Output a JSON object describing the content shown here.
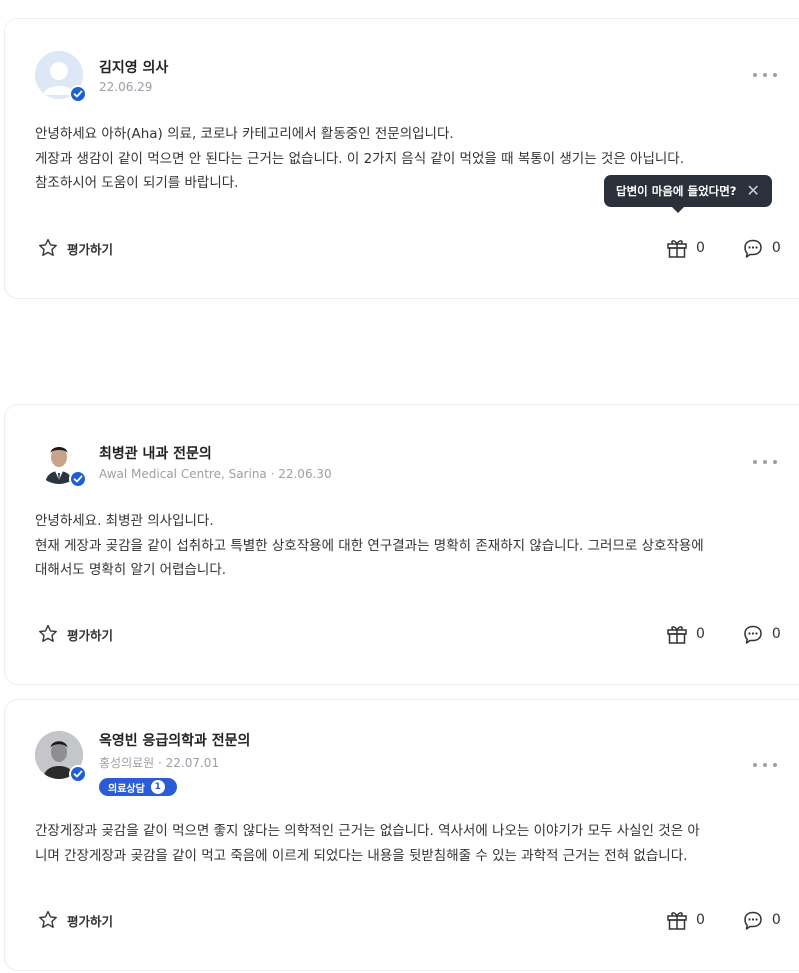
{
  "answers": [
    {
      "name": "김지영 의사",
      "meta": "22.06.29",
      "lines": [
        "안녕하세요 아하(Aha) 의료, 코로나 카테고리에서 활동중인 전문의입니다.",
        "게장과 생감이 같이 먹으면 안 된다는 근거는 없습니다. 이 2가지 음식 같이 먹었을 때 복통이 생기는 것은 아닙니다.",
        "참조하시어 도움이 되기를 바랍니다."
      ],
      "rate_label": "평가하기",
      "gift_count": "0",
      "comment_count": "0"
    },
    {
      "name": "최병관 내과 전문의",
      "meta": "Awal Medical Centre, Sarina · 22.06.30",
      "lines": [
        "안녕하세요. 최병관 의사입니다.",
        "현재 게장과 곶감을 같이 섭취하고 특별한 상호작용에 대한 연구결과는 명확히 존재하지 않습니다. 그러므로 상호작용에",
        "대해서도 명확히 알기 어렵습니다."
      ],
      "rate_label": "평가하기",
      "gift_count": "0",
      "comment_count": "0"
    },
    {
      "name": "옥영빈 응급의학과 전문의",
      "meta": "홍성의료원 · 22.07.01",
      "consult_label": "의료상담",
      "consult_count": "1",
      "lines": [
        "간장게장과 곶감을 같이 먹으면 좋지 않다는 의학적인 근거는 없습니다. 역사서에 나오는 이야기가 모두 사실인 것은 아",
        "니며 간장게장과 곶감을 같이 먹고 죽음에 이르게 되었다는 내용을 뒷받침해줄 수 있는 과학적 근거는 전혀 없습니다."
      ],
      "rate_label": "평가하기",
      "gift_count": "0",
      "comment_count": "0"
    }
  ],
  "tooltip": {
    "text": "답변이 마음에 들었다면?"
  },
  "colors": {
    "verified_badge": "#1f5fd6",
    "tooltip_bg": "#2b313b",
    "consult_badge": "#2b5bd7"
  }
}
